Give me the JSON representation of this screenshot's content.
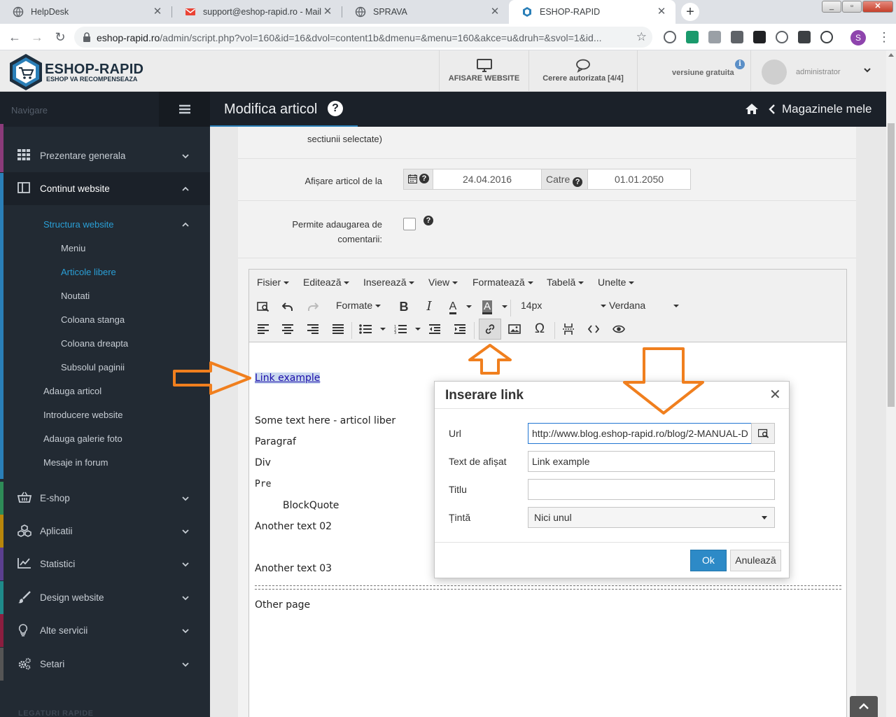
{
  "browser": {
    "tabs": [
      {
        "title": "HelpDesk"
      },
      {
        "title": "support@eshop-rapid.ro - Mail -"
      },
      {
        "title": "SPRAVA"
      },
      {
        "title": "ESHOP-RAPID"
      }
    ],
    "url_host": "eshop-rapid.ro",
    "url_path": "/admin/script.php?vol=160&id=16&dvol=content1b&dmenu=&menu=160&akce=u&druh=&svol=1&id...",
    "profile_initial": "S"
  },
  "header": {
    "logo_title": "ESHOP-RAPID",
    "logo_tagline": "ESHOP VA RECOMPENSEAZA",
    "view_website": "AFISARE WEBSITE",
    "authorization": "Cerere autorizata [4/4]",
    "version": "versiune gratuita",
    "user": "administrator"
  },
  "sidebar": {
    "nav_label": "Navigare",
    "items": {
      "overview": "Prezentare generala",
      "content": "Continut website",
      "structure": "Structura website",
      "menu": "Meniu",
      "free_articles": "Articole libere",
      "news": "Noutati",
      "left_column": "Coloana stanga",
      "right_column": "Coloana dreapta",
      "footer": "Subsolul paginii",
      "add_article": "Adauga articol",
      "intro_website": "Introducere website",
      "add_gallery": "Adauga galerie foto",
      "forum_messages": "Mesaje in forum",
      "eshop": "E-shop",
      "apps": "Aplicatii",
      "stats": "Statistici",
      "design": "Design website",
      "other_services": "Alte servicii",
      "settings": "Setari"
    },
    "bottom_label": "LEGATURI RAPIDE"
  },
  "content": {
    "page_title": "Modifica articol",
    "breadcrumb_link": "Magazinele mele"
  },
  "form": {
    "sections_note": "sectiunii selectate)",
    "display_label": "Afișare articol de la",
    "date_from": "24.04.2016",
    "date_to_label": "Catre",
    "date_to": "01.01.2050",
    "comments_label_1": "Permite adaugarea de",
    "comments_label_2": "comentarii:"
  },
  "editor": {
    "menus": {
      "file": "Fisier",
      "edit": "Editează",
      "insert": "Inserează",
      "view": "View",
      "format": "Formatează",
      "table": "Tabelă",
      "tools": "Unelte"
    },
    "formats_label": "Formate",
    "font_size": "14px",
    "font_family": "Verdana",
    "content": {
      "link": "Link example",
      "text1": "Some text here - articol liber",
      "paragraph": "Paragraf",
      "div": "Div",
      "pre": "Pre",
      "blockquote": "BlockQuote",
      "text2": "Another text 02",
      "text3": "Another text 03",
      "other_page": "Other page"
    }
  },
  "link_dialog": {
    "title": "Inserare link",
    "url_label": "Url",
    "url_value": "http://www.blog.eshop-rapid.ro/blog/2-MANUAL-D",
    "text_label": "Text de afișat",
    "text_value": "Link example",
    "title_label": "Titlu",
    "title_value": "",
    "target_label": "Țintă",
    "target_value": "Nici unul",
    "ok_label": "Ok",
    "cancel_label": "Anulează"
  },
  "colors": {
    "sidebar_bg": "#222a33",
    "accent_blue": "#2a9fd6",
    "annotation_orange": "#f07f1e",
    "ok_button": "#2d8ac7"
  }
}
